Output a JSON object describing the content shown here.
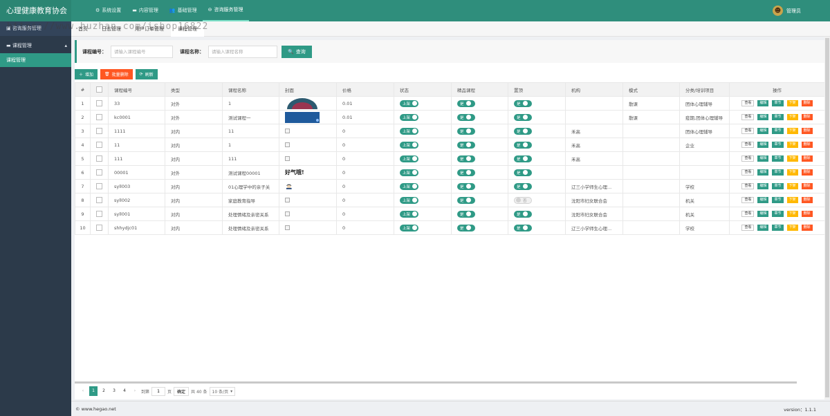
{
  "app": {
    "title": "心理健康教育协会"
  },
  "topnav": [
    {
      "icon": "gear-icon",
      "glyph": "⚙",
      "label": "系统设置",
      "active": false
    },
    {
      "icon": "folder-icon",
      "glyph": "▬",
      "label": "内容管理",
      "active": false
    },
    {
      "icon": "users-icon",
      "glyph": "👥",
      "label": "基础管理",
      "active": false
    },
    {
      "icon": "chat-icon",
      "glyph": "⊖",
      "label": "咨询服务管理",
      "active": true
    }
  ],
  "user": {
    "name": "管理员"
  },
  "sidebar": {
    "head": "咨询服务管理",
    "group": "课程管理",
    "item": "课程管理"
  },
  "tabs": [
    "首页",
    "日志管理",
    "用户订单管理",
    "课程管理"
  ],
  "watermark": "https://www.huzhan.com/ishop16822",
  "search": {
    "code_label": "课程编号：",
    "code_placeholder": "请输入课程编号",
    "name_label": "课程名称：",
    "name_placeholder": "请输入课程名称",
    "query_label": "查询"
  },
  "toolbar": {
    "add": "增加",
    "batch_delete": "批量删除",
    "refresh": "刷新"
  },
  "table": {
    "columns": [
      "#",
      "",
      "课程编号",
      "类型",
      "课程名称",
      "封面",
      "价格",
      "状态",
      "精品课程",
      "置顶",
      "机构",
      "模式",
      "分类/培训项目",
      "操作"
    ],
    "switch_labels": {
      "status_on": "上架",
      "yes": "是",
      "no": "否"
    },
    "op_labels": {
      "view": "查看",
      "edit": "编辑",
      "chapter": "章节",
      "off": "下架",
      "delete": "删除"
    },
    "rows": [
      {
        "n": "1",
        "code": "33",
        "type": "对外",
        "name": "1",
        "cover": "image-circle",
        "price": "0.01",
        "top": true,
        "org": "",
        "mode": "散课",
        "cat": "团体心理辅导"
      },
      {
        "n": "2",
        "code": "kc0001",
        "type": "对外",
        "name": "测试课程一",
        "cover": "image-blue",
        "price": "0.01",
        "top": true,
        "org": "",
        "mode": "散课",
        "cat": "疫期,团体心理辅导"
      },
      {
        "n": "3",
        "code": "1111",
        "type": "对内",
        "name": "11",
        "cover": "broken",
        "price": "0",
        "top": true,
        "org": "禾高",
        "mode": "",
        "cat": "团体心理辅导"
      },
      {
        "n": "4",
        "code": "11",
        "type": "对内",
        "name": "1",
        "cover": "broken",
        "price": "0",
        "top": true,
        "org": "禾高",
        "mode": "",
        "cat": "企业"
      },
      {
        "n": "5",
        "code": "111",
        "type": "对内",
        "name": "111",
        "cover": "broken",
        "price": "0",
        "top": true,
        "org": "禾高",
        "mode": "",
        "cat": ""
      },
      {
        "n": "6",
        "code": "00001",
        "type": "对外",
        "name": "测试课程00001",
        "cover": "text-image",
        "cover_text": "好气哦!",
        "price": "0",
        "top": true,
        "org": "",
        "mode": "",
        "cat": ""
      },
      {
        "n": "7",
        "code": "syll003",
        "type": "对内",
        "name": "01心理学中的亲子关",
        "cover": "face-image",
        "price": "0",
        "top": true,
        "org": "辽三小学师生心理...",
        "mode": "",
        "cat": "学校"
      },
      {
        "n": "8",
        "code": "syll002",
        "type": "对内",
        "name": "家庭教育指导",
        "cover": "broken",
        "price": "0",
        "top": false,
        "org": "沈阳市妇女联合会",
        "mode": "",
        "cat": "机关"
      },
      {
        "n": "9",
        "code": "syll001",
        "type": "对内",
        "name": "处理情绪及亲密关系",
        "cover": "broken",
        "price": "0",
        "top": true,
        "org": "沈阳市妇女联合会",
        "mode": "",
        "cat": "机关"
      },
      {
        "n": "10",
        "code": "shhydjc01",
        "type": "对内",
        "name": "处理情绪及亲密关系",
        "cover": "broken",
        "price": "0",
        "top": true,
        "org": "辽三小学师生心理...",
        "mode": "",
        "cat": "学校"
      }
    ]
  },
  "pager": {
    "prev": "‹",
    "pages": [
      "1",
      "2",
      "3",
      "4"
    ],
    "current": "1",
    "next": "›",
    "goto_label": "到第",
    "goto_value": "1",
    "page_unit": "页",
    "confirm": "确定",
    "total": "共 40 条",
    "per_page": "10 条/页"
  },
  "footer": {
    "copyright": "© www.hegao.net",
    "version": "version：1.1.1"
  },
  "colors": {
    "primary": "#2f9a86",
    "header": "#2f8e7c",
    "sidebar": "#2c3a4a",
    "danger": "#ff5722",
    "warn": "#ffb800"
  }
}
